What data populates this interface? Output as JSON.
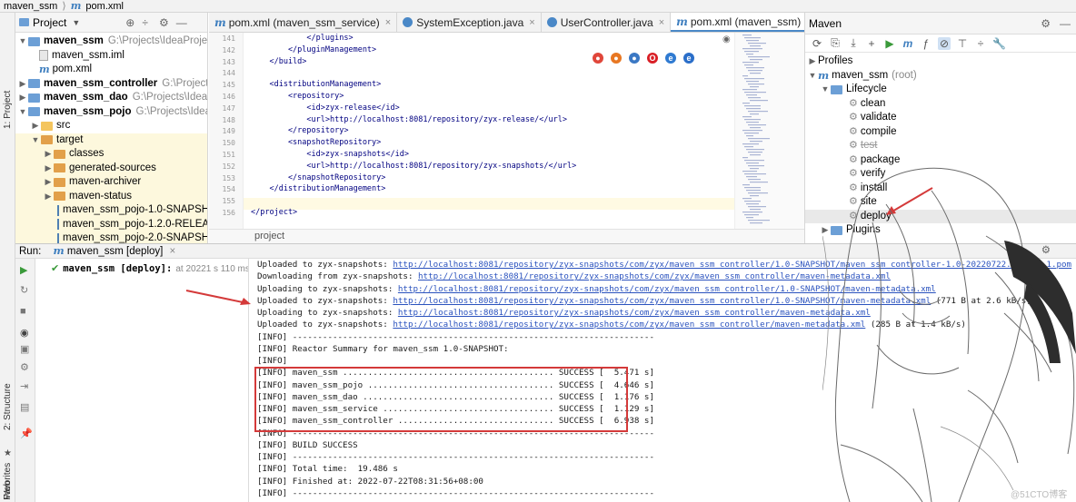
{
  "breadcrumb": {
    "project": "maven_ssm",
    "file": "pom.xml",
    "separator": "⟩"
  },
  "left_stripe": {
    "project_tab": "1: Project",
    "structure_tab": "2: Structure",
    "favorites_tab": "2: Favorites",
    "web_tab": "Web"
  },
  "project_panel": {
    "title": "Project",
    "tree": [
      {
        "name": "maven_ssm",
        "path": "G:\\Projects\\IdeaProjec",
        "bold": true
      },
      {
        "name": "maven_ssm.iml"
      },
      {
        "name": "pom.xml"
      },
      {
        "name": "maven_ssm_controller",
        "path": "G:\\Projects",
        "bold": true
      },
      {
        "name": "maven_ssm_dao",
        "path": "G:\\Projects\\IdeaPro",
        "bold": true
      },
      {
        "name": "maven_ssm_pojo",
        "path": "G:\\Projects\\IdeaP",
        "bold": true
      },
      {
        "name": "src"
      },
      {
        "name": "target"
      },
      {
        "name": "classes"
      },
      {
        "name": "generated-sources"
      },
      {
        "name": "maven-archiver"
      },
      {
        "name": "maven-status"
      },
      {
        "name": "maven_ssm_pojo-1.0-SNAPSHOT"
      },
      {
        "name": "maven_ssm_pojo-1.2.0-RELEAS"
      },
      {
        "name": "maven_ssm_pojo-2.0-SNAPSHOT"
      }
    ]
  },
  "editor": {
    "tabs": [
      {
        "label": "pom.xml (maven_ssm_service)"
      },
      {
        "label": "SystemException.java"
      },
      {
        "label": "UserController.java"
      },
      {
        "label": "pom.xml (maven_ssm)"
      }
    ],
    "line_numbers": [
      "141",
      "142",
      "143",
      "144",
      "145",
      "146",
      "147",
      "148",
      "149",
      "150",
      "151",
      "152",
      "153",
      "154",
      "155",
      "156"
    ],
    "code_lines": [
      "            </plugins>",
      "        </pluginManagement>",
      "    </build>",
      "",
      "    <distributionManagement>",
      "        <repository>",
      "            <id>zyx-release</id>",
      "            <url>http://localhost:8081/repository/zyx-release/</url>",
      "        </repository>",
      "        <snapshotRepository>",
      "            <id>zyx-snapshots</id>",
      "            <url>http://localhost:8081/repository/zyx-snapshots/</url>",
      "        </snapshotRepository>",
      "    </distributionManagement>",
      "",
      "</project>"
    ],
    "breadcrumb": "project"
  },
  "maven_panel": {
    "title": "Maven",
    "items": [
      {
        "label": "Profiles"
      },
      {
        "label": "maven_ssm",
        "suffix": "(root)"
      },
      {
        "label": "Lifecycle"
      },
      {
        "label": "clean"
      },
      {
        "label": "validate"
      },
      {
        "label": "compile"
      },
      {
        "label": "test"
      },
      {
        "label": "package"
      },
      {
        "label": "verify"
      },
      {
        "label": "install"
      },
      {
        "label": "site"
      },
      {
        "label": "deploy"
      },
      {
        "label": "Plugins"
      }
    ]
  },
  "run_panel": {
    "label": "Run:",
    "tab": "maven_ssm [deploy]",
    "tree_item": "maven_ssm [deploy]:",
    "tree_time": "at 20221 s 110 ms",
    "console": [
      {
        "prefix": "Uploaded to zyx-snapshots: ",
        "link": "http://localhost:8081/repository/zyx-snapshots/com/zyx/maven_ssm_controller/1.0-SNAPSHOT/maven_ssm_controller-1.0-20220722.003154-1.pom",
        "suffix": " (2.4 kB at 15"
      },
      {
        "prefix": "Downloading from zyx-snapshots: ",
        "link": "http://localhost:8081/repository/zyx-snapshots/com/zyx/maven_ssm_controller/maven-metadata.xml",
        "suffix": ""
      },
      {
        "prefix": "Uploading to zyx-snapshots: ",
        "link": "http://localhost:8081/repository/zyx-snapshots/com/zyx/maven_ssm_controller/1.0-SNAPSHOT/maven-metadata.xml",
        "suffix": ""
      },
      {
        "prefix": "Uploaded to zyx-snapshots: ",
        "link": "http://localhost:8081/repository/zyx-snapshots/com/zyx/maven_ssm_controller/1.0-SNAPSHOT/maven-metadata.xml",
        "suffix": " (771 B at 2.6 kB/s)"
      },
      {
        "prefix": "Uploading to zyx-snapshots: ",
        "link": "http://localhost:8081/repository/zyx-snapshots/com/zyx/maven_ssm_controller/maven-metadata.xml",
        "suffix": ""
      },
      {
        "prefix": "Uploaded to zyx-snapshots: ",
        "link": "http://localhost:8081/repository/zyx-snapshots/com/zyx/maven_ssm_controller/maven-metadata.xml",
        "suffix": " (285 B at 1.4 kB/s)"
      },
      {
        "text": "[INFO] ------------------------------------------------------------------------"
      },
      {
        "text": "[INFO] Reactor Summary for maven_ssm 1.0-SNAPSHOT:"
      },
      {
        "text": "[INFO]"
      },
      {
        "text": "[INFO] maven_ssm .......................................... SUCCESS [  5.471 s]"
      },
      {
        "text": "[INFO] maven_ssm_pojo ..................................... SUCCESS [  4.646 s]"
      },
      {
        "text": "[INFO] maven_ssm_dao ...................................... SUCCESS [  1.176 s]"
      },
      {
        "text": "[INFO] maven_ssm_service .................................. SUCCESS [  1.129 s]"
      },
      {
        "text": "[INFO] maven_ssm_controller ............................... SUCCESS [  6.938 s]"
      },
      {
        "text": "[INFO] ------------------------------------------------------------------------"
      },
      {
        "text": "[INFO] BUILD SUCCESS"
      },
      {
        "text": "[INFO] ------------------------------------------------------------------------"
      },
      {
        "text": "[INFO] Total time:  19.486 s"
      },
      {
        "text": "[INFO] Finished at: 2022-07-22T08:31:56+08:00"
      },
      {
        "text": "[INFO] ------------------------------------------------------------------------"
      }
    ]
  },
  "watermark": "@51CTO博客",
  "colors": {
    "accent": "#3f7fbf",
    "annotation_red": "#d43a3a",
    "link": "#2a52be"
  }
}
